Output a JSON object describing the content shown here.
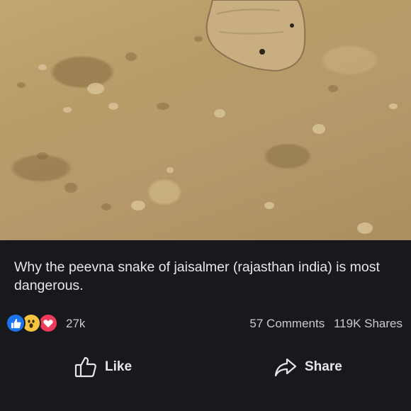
{
  "post": {
    "caption": "Why the peevna snake of jaisalmer (rajasthan india) is most dangerous.",
    "reaction_count": "27k",
    "comments": "57 Comments",
    "shares": "119K Shares"
  },
  "actions": {
    "like_label": "Like",
    "share_label": "Share"
  },
  "reactions": [
    "like-icon",
    "wow-icon",
    "love-icon"
  ],
  "colors": {
    "background": "#17191d",
    "text": "#e6e7ea",
    "like_blue": "#1e74f0",
    "love_red": "#ef3b5a",
    "wow_yellow": "#f7c63f"
  }
}
